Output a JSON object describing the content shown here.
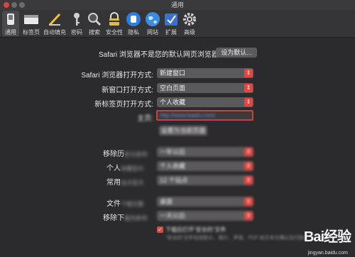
{
  "window": {
    "title": "通用"
  },
  "toolbar": {
    "tabs": [
      {
        "label": "通用",
        "icon": "general-switch-icon"
      },
      {
        "label": "标签页",
        "icon": "tabs-icon"
      },
      {
        "label": "自动填充",
        "icon": "autofill-pencil-icon"
      },
      {
        "label": "密码",
        "icon": "key-icon"
      },
      {
        "label": "搜索",
        "icon": "magnifier-icon"
      },
      {
        "label": "安全性",
        "icon": "lock-icon"
      },
      {
        "label": "隐私",
        "icon": "privacy-hand-icon"
      },
      {
        "label": "网站",
        "icon": "globe-icon"
      },
      {
        "label": "扩展",
        "icon": "extensions-icon"
      },
      {
        "label": "高级",
        "icon": "gear-icon"
      }
    ]
  },
  "default_browser": {
    "message": "Safari 浏览器不是您的默认网页浏览器。",
    "button": "设为默认..."
  },
  "settings": {
    "open_with_label": "Safari 浏览器打开方式:",
    "open_with_value": "新建窗口",
    "new_window_label": "新窗口打开方式:",
    "new_window_value": "空白页面",
    "new_tab_label": "新标签页打开方式:",
    "new_tab_value": "个人收藏",
    "homepage_label": "主页:",
    "homepage_value": "http://www.baidu.com/",
    "set_current_button": "设置为当前页面",
    "remove_history_label": "移除历",
    "remove_history_blur": "史记录项:",
    "remove_history_value": "一年以后",
    "favorites_label": "个人",
    "favorites_blur": "收藏显示:",
    "favorites_value": "个人收藏",
    "top_sites_label": "常用",
    "top_sites_blur": "站点显示:",
    "top_sites_value": "12 个站点",
    "downloads_label": "文件",
    "downloads_blur": "下载位置:",
    "downloads_value": "桌面",
    "remove_downloads_label": "移除下",
    "remove_downloads_blur": "载列表项:",
    "remove_downloads_value": "一天以后",
    "safe_files_checkbox": "下载后打开“安全的”文件",
    "safe_files_note": "“安全的”文件包括影片、图片、声音、PDF 和文本文稿以及归档"
  },
  "watermark": {
    "main": "Bai经验",
    "sub": "jingyan.baidu.com"
  },
  "colors": {
    "accent": "#e2463f",
    "background": "#2b2a2c"
  }
}
